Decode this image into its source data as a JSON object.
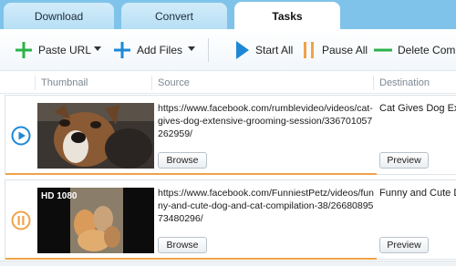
{
  "tabs": [
    {
      "label": "Download",
      "active": false
    },
    {
      "label": "Convert",
      "active": false
    },
    {
      "label": "Tasks",
      "active": true
    }
  ],
  "toolbar": {
    "paste_url": "Paste URL",
    "add_files": "Add Files",
    "start_all": "Start All",
    "pause_all": "Pause All",
    "delete_completed": "Delete Comple"
  },
  "columns": {
    "thumbnail": "Thumbnail",
    "source": "Source",
    "destination": "Destination"
  },
  "tasks": [
    {
      "status": "play-icon",
      "source": "https://www.facebook.com/rumblevideo/videos/cat-gives-dog-extensive-grooming-session/336701057262959/",
      "browse_label": "Browse",
      "destination": "Cat Gives Dog Ext",
      "preview_label": "Preview",
      "hd_badge": ""
    },
    {
      "status": "pause-icon",
      "source": "https://www.facebook.com/FunniestPetz/videos/funny-and-cute-dog-and-cat-compilation-38/2668089573480296/",
      "browse_label": "Browse",
      "destination": "Funny and Cute Do",
      "preview_label": "Preview",
      "hd_badge": "HD 1080"
    }
  ],
  "colors": {
    "tabbar": "#7fc3ea",
    "green": "#2bb34a",
    "blue": "#1e88d6",
    "orange": "#f0a24a"
  }
}
